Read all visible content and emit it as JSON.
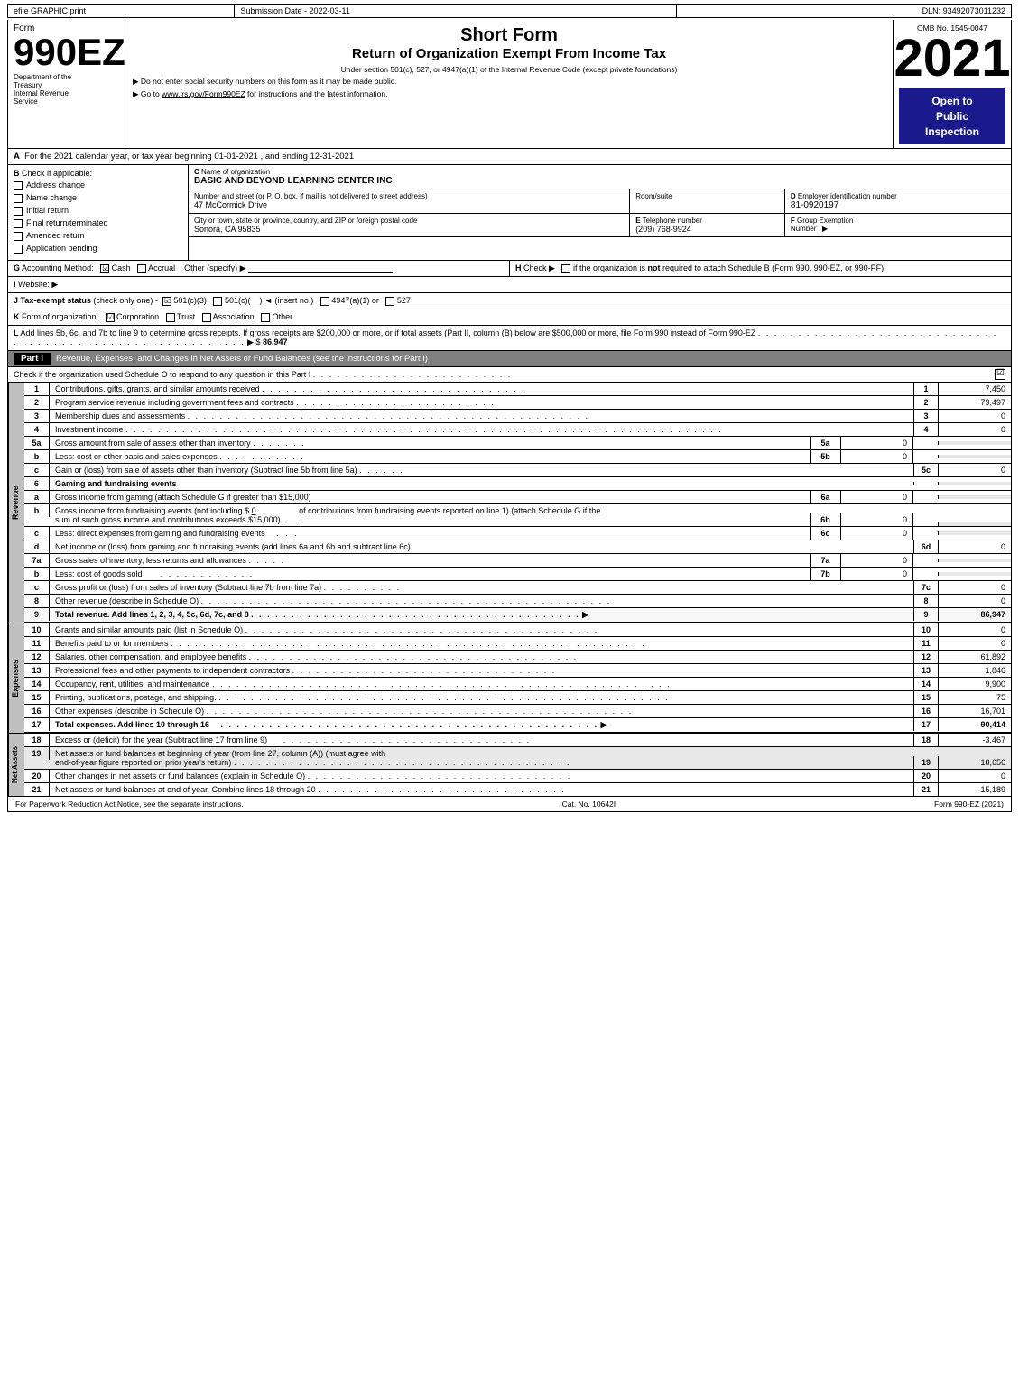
{
  "header": {
    "efile": "efile GRAPHIC print",
    "submission": "Submission Date - 2022-03-11",
    "dln": "DLN: 93492073011232",
    "form_label": "Form",
    "form_number": "990EZ",
    "dept1": "Department of the",
    "dept2": "Treasury",
    "dept3": "Internal Revenue",
    "dept4": "Service",
    "short_form": "Short Form",
    "return_title": "Return of Organization Exempt From Income Tax",
    "under_section": "Under section 501(c), 527, or 4947(a)(1) of the Internal Revenue Code (except private foundations)",
    "ssn_warning": "▶ Do not enter social security numbers on this form as it may be made public.",
    "goto": "▶ Go to",
    "goto_link": "www.irs.gov/Form990EZ",
    "goto_rest": "for instructions and the latest information.",
    "year": "2021",
    "omb": "OMB No. 1545-0047",
    "open_public": "Open to\nPublic\nInspection"
  },
  "section_a": {
    "label": "A",
    "text": "For the 2021 calendar year, or tax year beginning 01-01-2021 , and ending 12-31-2021"
  },
  "check_applicable": {
    "label": "B",
    "title": "Check if applicable:",
    "items": [
      {
        "id": "address_change",
        "checked": false,
        "label": "Address change"
      },
      {
        "id": "name_change",
        "checked": false,
        "label": "Name change"
      },
      {
        "id": "initial_return",
        "checked": false,
        "label": "Initial return"
      },
      {
        "id": "final_return",
        "checked": false,
        "label": "Final return/terminated"
      },
      {
        "id": "amended_return",
        "checked": false,
        "label": "Amended return"
      },
      {
        "id": "application_pending",
        "checked": false,
        "label": "Application pending"
      }
    ]
  },
  "org": {
    "c_label": "C",
    "name_label": "Name of organization",
    "name": "BASIC AND BEYOND LEARNING CENTER INC",
    "address_label": "Number and street (or P. O. box, if mail is not delivered to street address)",
    "address": "47 McCormick Drive",
    "room_label": "Room/suite",
    "room": "",
    "city_label": "City or town, state or province, country, and ZIP or foreign postal code",
    "city": "Sonora, CA  95835",
    "d_label": "D",
    "ein_label": "Employer identification number",
    "ein": "81-0920197",
    "e_label": "E",
    "phone_label": "Telephone number",
    "phone": "(209) 768-9924",
    "f_label": "F",
    "group_label": "F Group Exemption\nNumber",
    "group": "▶"
  },
  "accounting": {
    "g_label": "G",
    "method_label": "Accounting Method:",
    "cash_label": "Cash",
    "cash_checked": true,
    "accrual_label": "Accrual",
    "accrual_checked": false,
    "other_label": "Other (specify) ▶",
    "h_label": "H",
    "h_text": "Check ▶",
    "h_rest": "○ if the organization is not required to attach Schedule B (Form 990, 990-EZ, or 990-PF)."
  },
  "website": {
    "i_label": "I",
    "label": "Website: ▶"
  },
  "tax_status": {
    "j_label": "J",
    "label": "Tax-exempt status",
    "note": "(check only one) -",
    "s501c3_checked": true,
    "s501c3_label": "501(c)(3)",
    "s501c_label": "501(c)(",
    "s501c_checked": false,
    "insert_label": ") ◄ (insert no.)",
    "s4947_label": "4947(a)(1) or",
    "s4947_checked": false,
    "s527_label": "527",
    "s527_checked": false
  },
  "form_org": {
    "k_label": "K",
    "label": "Form of organization:",
    "corp_checked": true,
    "corp_label": "Corporation",
    "trust_checked": false,
    "trust_label": "Trust",
    "assoc_checked": false,
    "assoc_label": "Association",
    "other_checked": false,
    "other_label": "Other"
  },
  "gross_receipts": {
    "l_label": "L",
    "text": "Add lines 5b, 6c, and 7b to line 9 to determine gross receipts. If gross receipts are $200,000 or more, or if total assets (Part II, column (B) below are $500,000 or more, file Form 990 instead of Form 990-EZ",
    "dots": ". . . . . . . . . . . . . . . . . . . . . . . . . . . . . . . . . . . . . . . . . . . . . . . . . . . . . . . . . . .",
    "arrow": "▶ $",
    "amount": "86,947"
  },
  "part_i": {
    "label": "Part I",
    "title": "Revenue, Expenses, and Changes in Net Assets or Fund Balances",
    "see_instructions": "(see the instructions for Part I)",
    "check_text": "Check if the organization used Schedule O to respond to any question in this Part I",
    "check_dots": ". . . . . . . . . . . . . . . . . . . . . . . . .",
    "check_box": true,
    "rows": [
      {
        "num": "1",
        "desc": "Contributions, gifts, grants, and similar amounts received",
        "dots": ". . . . . . . . . . . . . . . . . . . . . . . . . . . . . . . . .",
        "line": "1",
        "amount": "7,450"
      },
      {
        "num": "2",
        "desc": "Program service revenue including government fees and contracts",
        "dots": ". . . . . . . . . . . . . . . . . . . . . . . . .",
        "line": "2",
        "amount": "79,497"
      },
      {
        "num": "3",
        "desc": "Membership dues and assessments",
        "dots": ". . . . . . . . . . . . . . . . . . . . . . . . . . . . . . . . . . . . . . . . . . . . . . . . . .",
        "line": "3",
        "amount": "0"
      },
      {
        "num": "4",
        "desc": "Investment income",
        "dots": ". . . . . . . . . . . . . . . . . . . . . . . . . . . . . . . . . . . . . . . . . . . . . . . . . . . . . . . . . . . . . . . . . . . . . . . . . .",
        "line": "4",
        "amount": "0"
      },
      {
        "num": "5a",
        "desc": "Gross amount from sale of assets other than inventory",
        "sub_dots": ". . . . . . .",
        "sub_line": "5a",
        "sub_amount": "0",
        "line": "",
        "amount": ""
      },
      {
        "num": "b",
        "desc": "Less: cost or other basis and sales expenses",
        "sub_dots": ". . . . . . . . . . .",
        "sub_line": "5b",
        "sub_amount": "0",
        "line": "",
        "amount": ""
      },
      {
        "num": "c",
        "desc": "Gain or (loss) from sale of assets other than inventory (Subtract line 5b from line 5a)",
        "dots": ". . . . . .",
        "line": "5c",
        "amount": "0",
        "sub_line": "",
        "sub_amount": ""
      }
    ]
  },
  "gaming_rows": [
    {
      "num": "6",
      "desc": "Gaming and fundraising events",
      "line": "",
      "amount": ""
    },
    {
      "num": "a",
      "desc": "Gross income from gaming (attach Schedule G if greater than $15,000)",
      "sub_line": "6a",
      "sub_amount": "0",
      "line": "",
      "amount": ""
    },
    {
      "num": "b",
      "desc": "Gross income from fundraising events (not including $",
      "amount_inline": "0",
      "desc2": "of contributions from fundraising events reported on line 1) (attach Schedule G if the sum of such gross income and contributions exceeds $15,000)",
      "sub_dots": ". .",
      "sub_line": "6b",
      "sub_amount": "0",
      "line": "",
      "amount": ""
    },
    {
      "num": "c",
      "desc": "Less: direct expenses from gaming and fundraising events",
      "sub_dots": ". . .",
      "sub_line": "6c",
      "sub_amount": "0",
      "line": "",
      "amount": ""
    },
    {
      "num": "d",
      "desc": "Net income or (loss) from gaming and fundraising events (add lines 6a and 6b and subtract line 6c)",
      "line": "6d",
      "amount": "0"
    },
    {
      "num": "7a",
      "desc": "Gross sales of inventory, less returns and allowances",
      "sub_dots": ". . . . .",
      "sub_line": "7a",
      "sub_amount": "0",
      "line": "",
      "amount": ""
    },
    {
      "num": "b",
      "desc": "Less: cost of goods sold",
      "sub_dots": ". . . . . . . . . . . .",
      "sub_line": "7b",
      "sub_amount": "0",
      "line": "",
      "amount": ""
    },
    {
      "num": "c",
      "desc": "Gross profit or (loss) from sales of inventory (Subtract line 7b from line 7a)",
      "dots": ". . . . . . . . . .",
      "line": "7c",
      "amount": "0"
    },
    {
      "num": "8",
      "desc": "Other revenue (describe in Schedule O)",
      "dots": ". . . . . . . . . . . . . . . . . . . . . . . . . . . . . . . . . . . . . . . . . . . . . . . . . . .",
      "line": "8",
      "amount": "0"
    },
    {
      "num": "9",
      "desc": "Total revenue. Add lines 1, 2, 3, 4, 5c, 6d, 7c, and 8",
      "dots": ". . . . . . . . . . . . . . . . . . . . . . . . . . . . . . . . . . . . . . . . .",
      "arrow": "▶",
      "line": "9",
      "amount": "86,947",
      "bold": true
    }
  ],
  "expenses_rows": [
    {
      "num": "10",
      "desc": "Grants and similar amounts paid (list in Schedule O)",
      "dots": ". . . . . . . . . . . . . . . . . . . . . . . . . . . . . . . . . . . . . . . . . . . . .",
      "line": "10",
      "amount": "0"
    },
    {
      "num": "11",
      "desc": "Benefits paid to or for members",
      "dots": ". . . . . . . . . . . . . . . . . . . . . . . . . . . . . . . . . . . . . . . . . . . . . . . . . . . . . . . . . . .",
      "line": "11",
      "amount": "0"
    },
    {
      "num": "12",
      "desc": "Salaries, other compensation, and employee benefits",
      "dots": ". . . . . . . . . . . . . . . . . . . . . . . . . . . . . . . . . . . . . . . . .",
      "line": "12",
      "amount": "61,892"
    },
    {
      "num": "13",
      "desc": "Professional fees and other payments to independent contractors",
      "dots": ". . . . . . . . . . . . . . . . . . . . . . . . . . . . . . . . .",
      "line": "13",
      "amount": "1,846"
    },
    {
      "num": "14",
      "desc": "Occupancy, rent, utilities, and maintenance",
      "dots": ". . . . . . . . . . . . . . . . . . . . . . . . . . . . . . . . . . . . . . . . . . . . . . . . . . . . . . . . .",
      "line": "14",
      "amount": "9,900"
    },
    {
      "num": "15",
      "desc": "Printing, publications, postage, and shipping.",
      "dots": ". . . . . . . . . . . . . . . . . . . . . . . . . . . . . . . . . . . . . . . . . . . . . . . . . . . . . . . .",
      "line": "15",
      "amount": "75"
    },
    {
      "num": "16",
      "desc": "Other expenses (describe in Schedule O)",
      "dots": ". . . . . . . . . . . . . . . . . . . . . . . . . . . . . . . . . . . . . . . . . . . . . . . . . . . . .",
      "line": "16",
      "amount": "16,701"
    },
    {
      "num": "17",
      "desc": "Total expenses. Add lines 10 through 16",
      "dots": ". . . . . . . . . . . . . . . . . . . . . . . . . . . . . . . . . . . . . . . . . . . . . . .",
      "arrow": "▶",
      "line": "17",
      "amount": "90,414",
      "bold": true
    }
  ],
  "net_assets_rows": [
    {
      "num": "18",
      "desc": "Excess or (deficit) for the year (Subtract line 17 from line 9)",
      "dots": ". . . . . . . . . . . . . . . . . . . . . . . . . . . . . . .",
      "line": "18",
      "amount": "-3,467"
    },
    {
      "num": "19",
      "desc": "Net assets or fund balances at beginning of year (from line 27, column (A)) (must agree with end-of-year figure reported on prior year's return)",
      "dots": ". . . . . . . . . . . . . . . . . . . . . . . . . . . . . . . . . . . . . . . . . .",
      "line": "19",
      "amount": "18,656"
    },
    {
      "num": "20",
      "desc": "Other changes in net assets or fund balances (explain in Schedule O)",
      "dots": ". . . . . . . . . . . . . . . . . . . . . . . . . . . . . . . . .",
      "line": "20",
      "amount": "0"
    },
    {
      "num": "21",
      "desc": "Net assets or fund balances at end of year. Combine lines 18 through 20",
      "dots": ". . . . . . . . . . . . . . . . . . . . . . . . . . . . . . .",
      "line": "21",
      "amount": "15,189"
    }
  ],
  "footer": {
    "paperwork": "For Paperwork Reduction Act Notice, see the separate instructions.",
    "cat": "Cat. No. 10642I",
    "form": "Form 990-EZ (2021)"
  }
}
